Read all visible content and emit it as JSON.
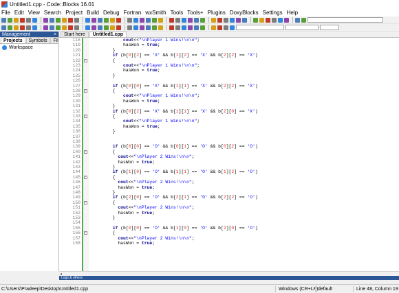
{
  "window": {
    "title": "Untitled1.cpp - Code::Blocks 16.01"
  },
  "menu": [
    "File",
    "Edit",
    "View",
    "Search",
    "Project",
    "Build",
    "Debug",
    "Fortran",
    "wxSmith",
    "Tools",
    "Tools+",
    "Plugins",
    "DoxyBlocks",
    "Settings",
    "Help"
  ],
  "management": {
    "title": "Management",
    "close": "×",
    "tabs": [
      "Projects",
      "Symbols",
      "Fil"
    ],
    "workspace": "Workspace"
  },
  "editor": {
    "tabs": [
      "Start here",
      "Untitled1.cpp"
    ],
    "lines": [
      {
        "n": "118",
        "tokens": [
          [
            "",
            "            "
          ],
          [
            "kw",
            "cout"
          ],
          [
            "op",
            "<<"
          ],
          [
            "str",
            "\"\\nPlayer 1 Wins!\\n\\n\""
          ],
          [
            "op",
            ";"
          ]
        ]
      },
      {
        "n": "119",
        "tokens": [
          [
            "",
            "            hasWon = "
          ],
          [
            "kw",
            "true"
          ],
          [
            "op",
            ";"
          ]
        ]
      },
      {
        "n": "120",
        "tokens": [
          [
            "",
            "        }"
          ]
        ]
      },
      {
        "n": "121",
        "tokens": [
          [
            "",
            "        "
          ],
          [
            "kw",
            "if"
          ],
          [
            "op",
            " (b["
          ],
          [
            "num",
            "0"
          ],
          [
            "op",
            "]["
          ],
          [
            "num",
            "2"
          ],
          [
            "op",
            "] == "
          ],
          [
            "str",
            "'X'"
          ],
          [
            "op",
            " && b["
          ],
          [
            "num",
            "1"
          ],
          [
            "op",
            "]["
          ],
          [
            "num",
            "2"
          ],
          [
            "op",
            "] == "
          ],
          [
            "str",
            "'X'"
          ],
          [
            "op",
            " && b["
          ],
          [
            "num",
            "2"
          ],
          [
            "op",
            "]["
          ],
          [
            "num",
            "2"
          ],
          [
            "op",
            "] == "
          ],
          [
            "str",
            "'X'"
          ],
          [
            "op",
            ")"
          ]
        ]
      },
      {
        "n": "122",
        "tokens": [
          [
            "",
            "        {"
          ]
        ],
        "fold": "-"
      },
      {
        "n": "123",
        "tokens": [
          [
            "",
            "            "
          ],
          [
            "kw",
            "cout"
          ],
          [
            "op",
            "<<"
          ],
          [
            "str",
            "\"\\nPlayer 1 Wins!\\n\\n\""
          ],
          [
            "op",
            ";"
          ]
        ]
      },
      {
        "n": "124",
        "tokens": [
          [
            "",
            "            hasWon = "
          ],
          [
            "kw",
            "true"
          ],
          [
            "op",
            ";"
          ]
        ]
      },
      {
        "n": "125",
        "tokens": [
          [
            "",
            "        }"
          ]
        ]
      },
      {
        "n": "126",
        "tokens": [
          [
            "",
            ""
          ]
        ]
      },
      {
        "n": "127",
        "tokens": [
          [
            "",
            "        "
          ],
          [
            "kw",
            "if"
          ],
          [
            "op",
            " (b["
          ],
          [
            "num",
            "0"
          ],
          [
            "op",
            "]["
          ],
          [
            "num",
            "0"
          ],
          [
            "op",
            "] == "
          ],
          [
            "str",
            "'X'"
          ],
          [
            "op",
            " && b["
          ],
          [
            "num",
            "1"
          ],
          [
            "op",
            "]["
          ],
          [
            "num",
            "1"
          ],
          [
            "op",
            "] == "
          ],
          [
            "str",
            "'X'"
          ],
          [
            "op",
            " && b["
          ],
          [
            "num",
            "2"
          ],
          [
            "op",
            "]["
          ],
          [
            "num",
            "2"
          ],
          [
            "op",
            "] == "
          ],
          [
            "str",
            "'X'"
          ],
          [
            "op",
            ")"
          ]
        ]
      },
      {
        "n": "128",
        "tokens": [
          [
            "",
            "        {"
          ]
        ],
        "fold": "-"
      },
      {
        "n": "129",
        "tokens": [
          [
            "",
            "            "
          ],
          [
            "kw",
            "cout"
          ],
          [
            "op",
            "<<"
          ],
          [
            "str",
            "\"\\nPlayer 1 Wins!\\n\\n\""
          ],
          [
            "op",
            ";"
          ]
        ]
      },
      {
        "n": "130",
        "tokens": [
          [
            "",
            "            hasWon = "
          ],
          [
            "kw",
            "true"
          ],
          [
            "op",
            ";"
          ]
        ]
      },
      {
        "n": "131",
        "tokens": [
          [
            "",
            "        }"
          ]
        ]
      },
      {
        "n": "132",
        "tokens": [
          [
            "",
            "        "
          ],
          [
            "kw",
            "if"
          ],
          [
            "op",
            " (b["
          ],
          [
            "num",
            "0"
          ],
          [
            "op",
            "]["
          ],
          [
            "num",
            "2"
          ],
          [
            "op",
            "] == "
          ],
          [
            "str",
            "'X'"
          ],
          [
            "op",
            " && b["
          ],
          [
            "num",
            "1"
          ],
          [
            "op",
            "]["
          ],
          [
            "num",
            "1"
          ],
          [
            "op",
            "] == "
          ],
          [
            "str",
            "'X'"
          ],
          [
            "op",
            " && b["
          ],
          [
            "num",
            "2"
          ],
          [
            "op",
            "]["
          ],
          [
            "num",
            "0"
          ],
          [
            "op",
            "] == "
          ],
          [
            "str",
            "'X'"
          ],
          [
            "op",
            ")"
          ]
        ]
      },
      {
        "n": "133",
        "tokens": [
          [
            "",
            "        {"
          ]
        ],
        "fold": "-"
      },
      {
        "n": "134",
        "tokens": [
          [
            "",
            "            "
          ],
          [
            "kw",
            "cout"
          ],
          [
            "op",
            "<<"
          ],
          [
            "str",
            "\"\\nPlayer 1 Wins!\\n\\n\""
          ],
          [
            "op",
            ";"
          ]
        ]
      },
      {
        "n": "135",
        "tokens": [
          [
            "",
            "            hasWon = "
          ],
          [
            "kw",
            "true"
          ],
          [
            "op",
            ";"
          ]
        ]
      },
      {
        "n": "136",
        "tokens": [
          [
            "",
            "        }"
          ]
        ]
      },
      {
        "n": "137",
        "tokens": [
          [
            "",
            ""
          ]
        ]
      },
      {
        "n": "138",
        "tokens": [
          [
            "",
            ""
          ]
        ]
      },
      {
        "n": "139",
        "tokens": [
          [
            "",
            "        "
          ],
          [
            "kw",
            "if"
          ],
          [
            "op",
            " (b["
          ],
          [
            "num",
            "0"
          ],
          [
            "op",
            "]["
          ],
          [
            "num",
            "0"
          ],
          [
            "op",
            "] == "
          ],
          [
            "str",
            "'O'"
          ],
          [
            "op",
            " && b["
          ],
          [
            "num",
            "0"
          ],
          [
            "op",
            "]["
          ],
          [
            "num",
            "1"
          ],
          [
            "op",
            "] == "
          ],
          [
            "str",
            "'O'"
          ],
          [
            "op",
            " && b["
          ],
          [
            "num",
            "0"
          ],
          [
            "op",
            "]["
          ],
          [
            "num",
            "2"
          ],
          [
            "op",
            "] == "
          ],
          [
            "str",
            "'O'"
          ],
          [
            "op",
            ")"
          ]
        ]
      },
      {
        "n": "140",
        "tokens": [
          [
            "",
            "        {"
          ]
        ],
        "fold": "-"
      },
      {
        "n": "141",
        "tokens": [
          [
            "",
            "          "
          ],
          [
            "kw",
            "cout"
          ],
          [
            "op",
            "<<"
          ],
          [
            "str",
            "\"\\nPlayer 2 Wins!\\n\\n\""
          ],
          [
            "op",
            ";"
          ]
        ]
      },
      {
        "n": "142",
        "tokens": [
          [
            "",
            "          hasWon = "
          ],
          [
            "kw",
            "true"
          ],
          [
            "op",
            ";"
          ]
        ]
      },
      {
        "n": "143",
        "tokens": [
          [
            "",
            "        }"
          ]
        ]
      },
      {
        "n": "144",
        "tokens": [
          [
            "",
            "        "
          ],
          [
            "kw",
            "if"
          ],
          [
            "op",
            " (b["
          ],
          [
            "num",
            "1"
          ],
          [
            "op",
            "]["
          ],
          [
            "num",
            "0"
          ],
          [
            "op",
            "] == "
          ],
          [
            "str",
            "'O'"
          ],
          [
            "op",
            " && b["
          ],
          [
            "num",
            "1"
          ],
          [
            "op",
            "]["
          ],
          [
            "num",
            "1"
          ],
          [
            "op",
            "] == "
          ],
          [
            "str",
            "'O'"
          ],
          [
            "op",
            " && b["
          ],
          [
            "num",
            "1"
          ],
          [
            "op",
            "]["
          ],
          [
            "num",
            "2"
          ],
          [
            "op",
            "] == "
          ],
          [
            "str",
            "'O'"
          ],
          [
            "op",
            ")"
          ]
        ]
      },
      {
        "n": "145",
        "tokens": [
          [
            "",
            "        {"
          ]
        ],
        "fold": "-"
      },
      {
        "n": "146",
        "tokens": [
          [
            "",
            "          "
          ],
          [
            "kw",
            "cout"
          ],
          [
            "op",
            "<<"
          ],
          [
            "str",
            "\"\\nPlayer 2 Wins!\\n\\n\""
          ],
          [
            "op",
            ";"
          ]
        ]
      },
      {
        "n": "147",
        "tokens": [
          [
            "",
            "          hasWon = "
          ],
          [
            "kw",
            "true"
          ],
          [
            "op",
            ";"
          ]
        ]
      },
      {
        "n": "148",
        "tokens": [
          [
            "",
            "        }"
          ]
        ]
      },
      {
        "n": "149",
        "tokens": [
          [
            "",
            "        "
          ],
          [
            "kw",
            "if"
          ],
          [
            "op",
            " (b["
          ],
          [
            "num",
            "2"
          ],
          [
            "op",
            "]["
          ],
          [
            "num",
            "0"
          ],
          [
            "op",
            "] == "
          ],
          [
            "str",
            "'O'"
          ],
          [
            "op",
            " && b["
          ],
          [
            "num",
            "2"
          ],
          [
            "op",
            "]["
          ],
          [
            "num",
            "1"
          ],
          [
            "op",
            "] == "
          ],
          [
            "str",
            "'O'"
          ],
          [
            "op",
            " && b["
          ],
          [
            "num",
            "2"
          ],
          [
            "op",
            "]["
          ],
          [
            "num",
            "2"
          ],
          [
            "op",
            "] == "
          ],
          [
            "str",
            "'O'"
          ],
          [
            "op",
            ")"
          ]
        ]
      },
      {
        "n": "150",
        "tokens": [
          [
            "",
            "        {"
          ]
        ],
        "fold": "-"
      },
      {
        "n": "151",
        "tokens": [
          [
            "",
            "          "
          ],
          [
            "kw",
            "cout"
          ],
          [
            "op",
            "<<"
          ],
          [
            "str",
            "\"\\nPlayer 2 Wins!\\n\\n\""
          ],
          [
            "op",
            ";"
          ]
        ]
      },
      {
        "n": "152",
        "tokens": [
          [
            "",
            "          hasWon = "
          ],
          [
            "kw",
            "true"
          ],
          [
            "op",
            ";"
          ]
        ]
      },
      {
        "n": "153",
        "tokens": [
          [
            "",
            "        }"
          ]
        ]
      },
      {
        "n": "154",
        "tokens": [
          [
            "",
            ""
          ]
        ]
      },
      {
        "n": "155",
        "tokens": [
          [
            "",
            "        "
          ],
          [
            "kw",
            "if"
          ],
          [
            "op",
            " (b["
          ],
          [
            "num",
            "0"
          ],
          [
            "op",
            "]["
          ],
          [
            "num",
            "0"
          ],
          [
            "op",
            "] == "
          ],
          [
            "str",
            "'O'"
          ],
          [
            "op",
            " && b["
          ],
          [
            "num",
            "1"
          ],
          [
            "op",
            "]["
          ],
          [
            "num",
            "0"
          ],
          [
            "op",
            "] == "
          ],
          [
            "str",
            "'O'"
          ],
          [
            "op",
            " && b["
          ],
          [
            "num",
            "2"
          ],
          [
            "op",
            "]["
          ],
          [
            "num",
            "0"
          ],
          [
            "op",
            "] == "
          ],
          [
            "str",
            "'O'"
          ],
          [
            "op",
            ")"
          ]
        ]
      },
      {
        "n": "156",
        "tokens": [
          [
            "",
            "        {"
          ]
        ],
        "fold": "-"
      },
      {
        "n": "157",
        "tokens": [
          [
            "",
            "          "
          ],
          [
            "kw",
            "cout"
          ],
          [
            "op",
            "<<"
          ],
          [
            "str",
            "\"\\nPlayer 2 Wins!\\n\\n\""
          ],
          [
            "op",
            ";"
          ]
        ]
      },
      {
        "n": "158",
        "tokens": [
          [
            "",
            "          hasWon = "
          ],
          [
            "kw",
            "true"
          ],
          [
            "op",
            ";"
          ]
        ]
      }
    ]
  },
  "log": {
    "title": "Logs & others"
  },
  "status": {
    "path": "C:\\Users\\Pradeep\\Desktop\\Untitled1.cpp",
    "line_endings": "Windows (CR+LF)",
    "encoding": "default",
    "position": "Line 48, Column 19"
  },
  "colors": {
    "keyword": "#00008b",
    "string": "#0000ff",
    "number": "#e0301e",
    "change_bar": "#4caf50",
    "panel_header": "#2b5797"
  }
}
